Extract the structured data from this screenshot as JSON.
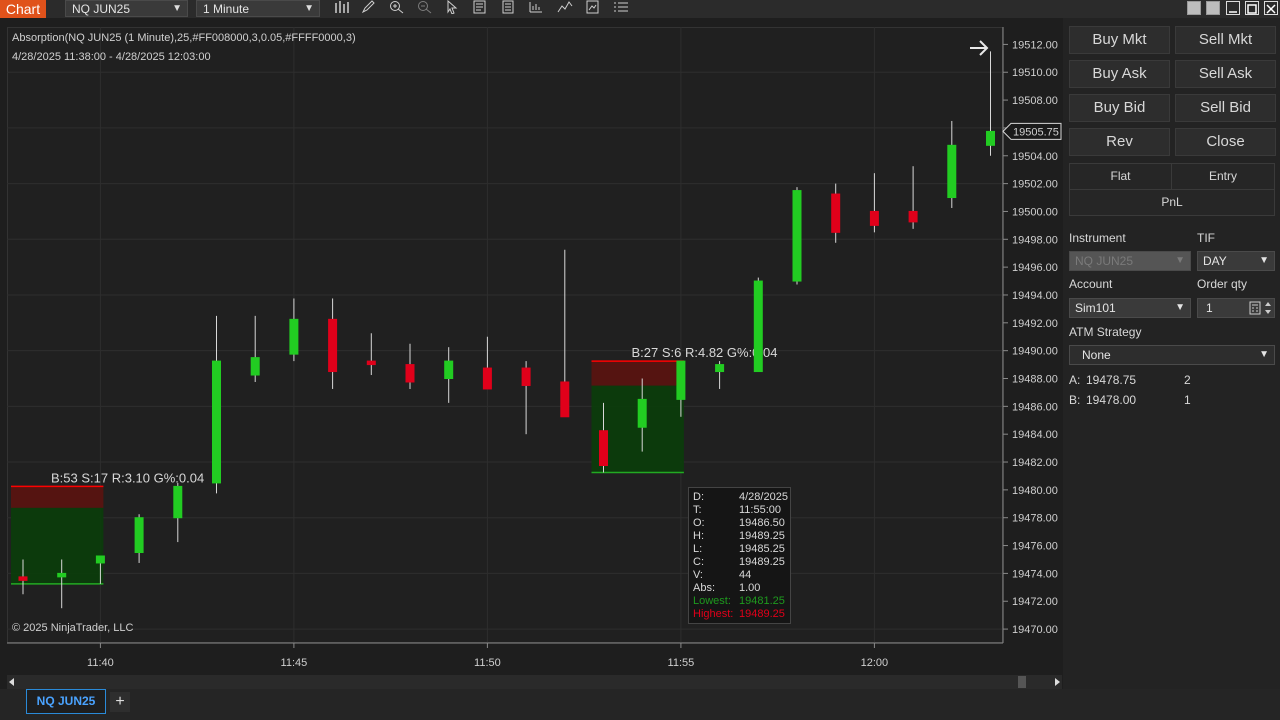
{
  "toolbar": {
    "chart_label": "Chart",
    "instrument": "NQ JUN25",
    "interval": "1 Minute",
    "tools": [
      "bars-icon",
      "pencil-icon",
      "zoom-in-icon",
      "zoom-out-icon",
      "pointer-icon",
      "data-box-icon",
      "properties-icon",
      "strategy-icon",
      "indicator-icon",
      "template-icon",
      "menu-icon"
    ]
  },
  "chart": {
    "indicator_label": "Absorption(NQ JUN25 (1 Minute),25,#FF008000,3,0.05,#FFFF0000,3)",
    "range_label": "4/28/2025 11:38:00 - 4/28/2025 12:03:00",
    "copyright": "© 2025 NinjaTrader, LLC",
    "current_price": "19505.75",
    "price_ticks": [
      "19512.00",
      "19510.00",
      "19508.00",
      "19506.00",
      "19504.00",
      "19502.00",
      "19500.00",
      "19498.00",
      "19496.00",
      "19494.00",
      "19492.00",
      "19490.00",
      "19488.00",
      "19486.00",
      "19484.00",
      "19482.00",
      "19480.00",
      "19478.00",
      "19476.00",
      "19474.00",
      "19472.00",
      "19470.00"
    ],
    "time_ticks": [
      "11:40",
      "11:45",
      "11:50",
      "11:55",
      "12:00"
    ],
    "absorption_zones": [
      {
        "label": "B:53 S:17 R:3.10 G%:0.04",
        "low": 19473.25,
        "high": 19480.25,
        "start": 0,
        "end": 2
      },
      {
        "label": "B:27 S:6 R:4.82 G%:0.04",
        "low": 19481.25,
        "high": 19489.25,
        "start": 15,
        "end": 17
      }
    ],
    "colors": {
      "up": "#22cc22",
      "down": "#e0001a",
      "zone_green": "#0a3d0a",
      "zone_red": "#5a1212"
    }
  },
  "chart_data": {
    "type": "candlestick",
    "x": [
      "11:38",
      "11:39",
      "11:40",
      "11:41",
      "11:42",
      "11:43",
      "11:44",
      "11:45",
      "11:46",
      "11:47",
      "11:48",
      "11:49",
      "11:50",
      "11:51",
      "11:52",
      "11:53",
      "11:54",
      "11:55",
      "11:56",
      "11:57",
      "11:58",
      "11:59",
      "12:00",
      "12:01",
      "12:02",
      "12:03"
    ],
    "open": [
      19473.75,
      19473.75,
      19474.75,
      19475.5,
      19478.0,
      19480.5,
      19488.25,
      19489.75,
      19492.25,
      19489.25,
      19489.0,
      19488.0,
      19488.75,
      19488.75,
      19487.75,
      19484.25,
      19484.5,
      19486.5,
      19488.5,
      19488.5,
      19495.0,
      19501.25,
      19500.0,
      19500.0,
      19501.0,
      19504.75
    ],
    "high": [
      19475.0,
      19475.0,
      19475.25,
      19478.25,
      19480.5,
      19492.5,
      19492.5,
      19493.75,
      19493.75,
      19491.25,
      19490.5,
      19490.25,
      19491.0,
      19489.25,
      19497.25,
      19486.25,
      19488.0,
      19489.25,
      19489.25,
      19495.25,
      19501.75,
      19502.0,
      19502.75,
      19503.25,
      19506.5,
      19511.5
    ],
    "low": [
      19472.5,
      19471.5,
      19473.25,
      19474.75,
      19476.25,
      19479.75,
      19487.75,
      19489.25,
      19487.25,
      19488.25,
      19487.25,
      19486.25,
      19487.25,
      19484.0,
      19485.25,
      19481.25,
      19482.75,
      19485.25,
      19487.25,
      19488.5,
      19494.75,
      19497.75,
      19498.5,
      19498.75,
      19500.25,
      19504.0
    ],
    "close": [
      19473.5,
      19474.0,
      19475.25,
      19478.0,
      19480.25,
      19489.25,
      19489.5,
      19492.25,
      19488.5,
      19489.0,
      19487.75,
      19489.25,
      19487.25,
      19487.5,
      19485.25,
      19481.75,
      19486.5,
      19489.25,
      19489.0,
      19495.0,
      19501.5,
      19498.5,
      19499.0,
      19499.25,
      19504.75,
      19505.75
    ],
    "ylim": [
      19469.0,
      19513.25
    ],
    "title": "",
    "xlabel": "",
    "ylabel": ""
  },
  "tooltip": {
    "rows": [
      {
        "k": "D:",
        "v": "4/28/2025"
      },
      {
        "k": "T:",
        "v": "11:55:00"
      },
      {
        "k": "O:",
        "v": "19486.50"
      },
      {
        "k": "H:",
        "v": "19489.25"
      },
      {
        "k": "L:",
        "v": "19485.25"
      },
      {
        "k": "C:",
        "v": "19489.25"
      },
      {
        "k": "V:",
        "v": "44"
      },
      {
        "k": "Abs:",
        "v": "1.00"
      }
    ],
    "lowest_k": "Lowest:",
    "lowest_v": "19481.25",
    "highest_k": "Highest:",
    "highest_v": "19489.25"
  },
  "order_panel": {
    "buy_mkt": "Buy Mkt",
    "sell_mkt": "Sell Mkt",
    "buy_ask": "Buy Ask",
    "sell_ask": "Sell Ask",
    "buy_bid": "Buy Bid",
    "sell_bid": "Sell Bid",
    "rev": "Rev",
    "close": "Close",
    "flat": "Flat",
    "entry": "Entry",
    "pnl": "PnL",
    "instrument_label": "Instrument",
    "instrument_value": "NQ JUN25",
    "tif_label": "TIF",
    "tif_value": "DAY",
    "account_label": "Account",
    "account_value": "Sim101",
    "qty_label": "Order qty",
    "qty_value": "1",
    "atm_label": "ATM Strategy",
    "atm_value": "None",
    "ask_label": "A:",
    "ask_price": "19478.75",
    "ask_qty": "2",
    "bid_label": "B:",
    "bid_price": "19478.00",
    "bid_qty": "1"
  },
  "bottom": {
    "tab_label": "NQ JUN25",
    "add_label": "+"
  }
}
